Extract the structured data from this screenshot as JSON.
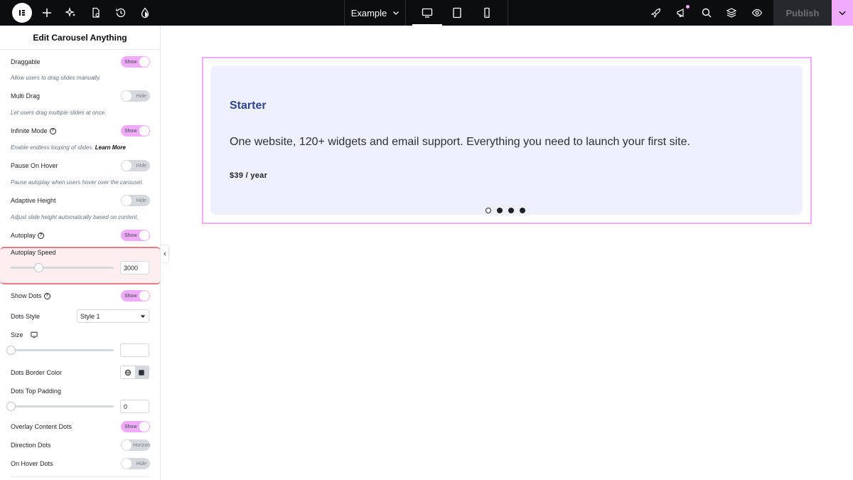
{
  "topbar": {
    "site_name": "Example",
    "publish_label": "Publish"
  },
  "panel": {
    "title": "Edit Carousel Anything",
    "rows": {
      "draggable": {
        "label": "Draggable",
        "state": "Show",
        "desc": "Allow users to drag slides manually."
      },
      "multi_drag": {
        "label": "Multi Drag",
        "state": "Hide",
        "desc": "Let users drag multiple slides at once."
      },
      "infinite_mode": {
        "label": "Infinite Mode",
        "state": "Show",
        "desc": "Enable endless looping of slides.",
        "link": "Learn More"
      },
      "pause_on_hover": {
        "label": "Pause On Hover",
        "state": "Hide",
        "desc": "Pause autoplay when users hover over the carousel."
      },
      "adaptive_height": {
        "label": "Adaptive Height",
        "state": "Hide",
        "desc": "Adjust slide height automatically based on content."
      },
      "autoplay": {
        "label": "Autoplay",
        "state": "Show"
      },
      "autoplay_speed": {
        "label": "Autoplay Speed",
        "value": "3000"
      },
      "show_dots": {
        "label": "Show Dots",
        "state": "Show"
      },
      "dots_style": {
        "label": "Dots Style",
        "value": "Style 1"
      },
      "size": {
        "label": "Size",
        "value": ""
      },
      "dots_border_color": {
        "label": "Dots Border Color"
      },
      "dots_top_padding": {
        "label": "Dots Top Padding",
        "value": "0"
      },
      "overlay_content_dots": {
        "label": "Overlay Content Dots",
        "state": "Show"
      },
      "direction_dots": {
        "label": "Direction Dots",
        "state": "Horizontal"
      },
      "on_hover_dots": {
        "label": "On Hover Dots",
        "state": "Hide"
      }
    }
  },
  "slide": {
    "title": "Starter",
    "text": "One website, 120+ widgets and email support. Everything you need to launch your first site.",
    "price": "$39 / year",
    "dots_count": 4,
    "active_dot": 0
  },
  "colors": {
    "accent": "#f0abfc",
    "slide_bg": "#eef1fd",
    "title_color": "#2f4590",
    "highlight_border": "#e87987"
  }
}
